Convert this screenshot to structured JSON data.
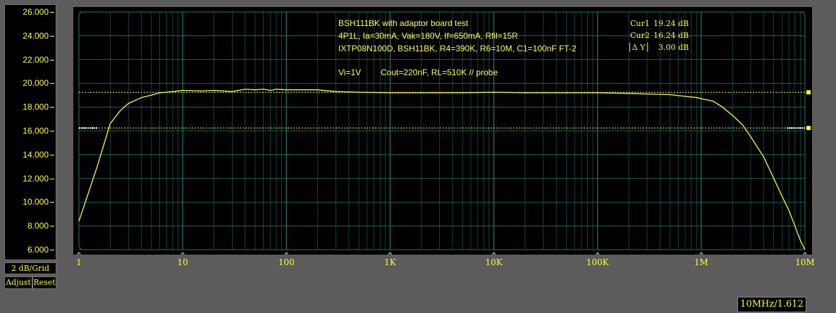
{
  "yaxis": {
    "ticks": [
      "26.000",
      "24.000",
      "22.000",
      "20.000",
      "18.000",
      "16.000",
      "14.000",
      "12.000",
      "10.000",
      "8.000",
      "6.000"
    ],
    "grid_label": "2 dB/Grid",
    "adjust_label": "Adjust",
    "reset_label": "Reset"
  },
  "annotations": {
    "line1": "BSH111BK with adaptor board test",
    "line2": "4P1L, Ia=30mA, Vak=180V, If=650mA, Rfil=15R",
    "line3": "IXTP08N100D, BSH11BK, R4=390K, R6=10M, C1=100nF FT-2",
    "line4a": "Vi=1V",
    "line4b": "Cout=220nF, RL=510K // probe"
  },
  "cursors": {
    "cur1_label": "Cur1",
    "cur1_value": "19.24  dB",
    "cur2_label": "Cur2",
    "cur2_value": "16.24  dB",
    "delta_label": "│Δ  Y│",
    "delta_value": "3.00 dB",
    "marker1": "Cur1",
    "marker2": "Cur2"
  },
  "footer": {
    "readout": "10MHz/1.612"
  },
  "colors": {
    "trace": "#ffff30",
    "grid": "#1f7a6e",
    "grid_minor": "#185d56",
    "background": "#000000"
  },
  "chart_data": {
    "type": "line",
    "title": "",
    "xlabel": "",
    "ylabel": "",
    "xscale": "log",
    "xlim": [
      1,
      10000000
    ],
    "ylim": [
      6,
      26
    ],
    "x_tick_labels": [
      "1",
      "10",
      "100",
      "1K",
      "10K",
      "100K",
      "1M",
      "10M"
    ],
    "y_tick_labels": [
      "26.000",
      "24.000",
      "22.000",
      "20.000",
      "18.000",
      "16.000",
      "14.000",
      "12.000",
      "10.000",
      "8.000",
      "6.000"
    ],
    "grid": true,
    "cursors_y": [
      19.24,
      16.24
    ],
    "series": [
      {
        "x": [
          1,
          1.5,
          2,
          2.5,
          3,
          4,
          5,
          6,
          7,
          8,
          10,
          15,
          20,
          30,
          40,
          50,
          60,
          70,
          80,
          100,
          150,
          200,
          300,
          500,
          1000,
          2000,
          5000,
          10000,
          20000,
          50000,
          70000,
          100000,
          200000,
          300000,
          500000,
          700000,
          900000,
          1000000,
          1300000,
          1600000,
          2000000,
          2500000,
          3000000,
          4000000,
          5000000,
          6000000,
          7000000,
          8000000,
          9000000,
          10000000
        ],
        "y": [
          8.4,
          13.0,
          16.6,
          17.7,
          18.3,
          18.8,
          19.0,
          19.2,
          19.25,
          19.3,
          19.4,
          19.35,
          19.4,
          19.3,
          19.5,
          19.45,
          19.5,
          19.4,
          19.5,
          19.45,
          19.45,
          19.45,
          19.3,
          19.25,
          19.2,
          19.2,
          19.2,
          19.25,
          19.2,
          19.2,
          19.2,
          19.2,
          19.15,
          19.1,
          19.05,
          18.9,
          18.8,
          18.7,
          18.5,
          18.0,
          17.3,
          16.5,
          15.5,
          13.8,
          12.0,
          10.5,
          9.3,
          8.0,
          6.8,
          6.0
        ]
      }
    ]
  }
}
